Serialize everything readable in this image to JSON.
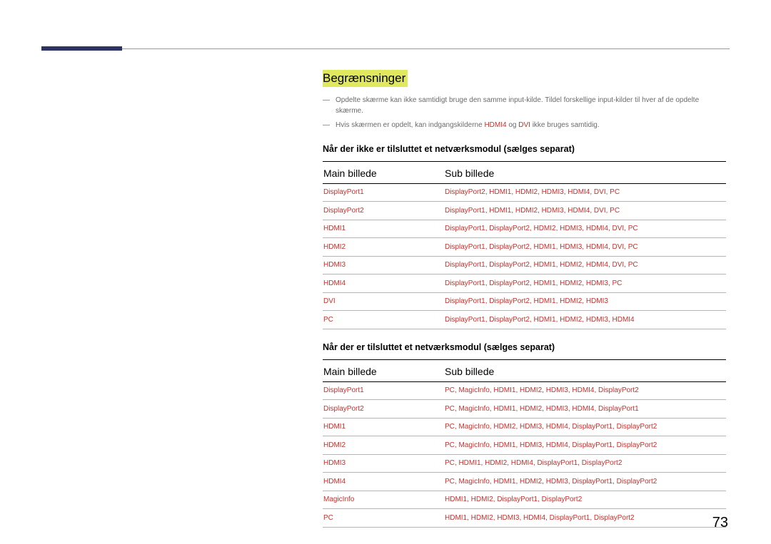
{
  "heading": "Begrænsninger",
  "notes": [
    "Opdelte skærme kan ikke samtidigt bruge den samme input-kilde. Tildel forskellige input-kilder til hver af de opdelte skærme.",
    "Hvis skærmen er opdelt, kan indgangskilderne <r>HDMI4</r> og <r>DVI</r> ikke bruges samtidig."
  ],
  "section1": {
    "title": "Når der ikke er tilsluttet et netværksmodul (sælges separat)",
    "col_main": "Main billede",
    "col_sub": "Sub billede",
    "rows": [
      {
        "main": "DisplayPort1",
        "sub": "DisplayPort2, HDMI1, HDMI2, HDMI3, HDMI4, DVI, PC"
      },
      {
        "main": "DisplayPort2",
        "sub": "DisplayPort1, HDMI1, HDMI2, HDMI3, HDMI4, DVI, PC"
      },
      {
        "main": "HDMI1",
        "sub": "DisplayPort1, DisplayPort2, HDMI2, HDMI3, HDMI4, DVI, PC"
      },
      {
        "main": "HDMI2",
        "sub": "DisplayPort1, DisplayPort2, HDMI1, HDMI3, HDMI4, DVI, PC"
      },
      {
        "main": "HDMI3",
        "sub": "DisplayPort1, DisplayPort2, HDMI1, HDMI2, HDMI4, DVI, PC"
      },
      {
        "main": "HDMI4",
        "sub": "DisplayPort1, DisplayPort2, HDMI1, HDMI2, HDMI3, PC"
      },
      {
        "main": "DVI",
        "sub": "DisplayPort1, DisplayPort2, HDMI1, HDMI2, HDMI3"
      },
      {
        "main": "PC",
        "sub": "DisplayPort1, DisplayPort2, HDMI1, HDMI2, HDMI3, HDMI4"
      }
    ]
  },
  "section2": {
    "title": "Når der er tilsluttet et netværksmodul (sælges separat)",
    "col_main": "Main billede",
    "col_sub": "Sub billede",
    "rows": [
      {
        "main": "DisplayPort1",
        "sub": "PC, MagicInfo, HDMI1, HDMI2, HDMI3, HDMI4, DisplayPort2"
      },
      {
        "main": "DisplayPort2",
        "sub": "PC, MagicInfo, HDMI1, HDMI2, HDMI3, HDMI4, DisplayPort1"
      },
      {
        "main": "HDMI1",
        "sub": "PC, MagicInfo, HDMI2, HDMI3, HDMI4, DisplayPort1, DisplayPort2"
      },
      {
        "main": "HDMI2",
        "sub": "PC, MagicInfo, HDMI1, HDMI3, HDMI4, DisplayPort1, DisplayPort2"
      },
      {
        "main": "HDMI3",
        "sub": "PC, HDMI1, HDMI2, HDMI4, DisplayPort1, DisplayPort2"
      },
      {
        "main": "HDMI4",
        "sub": "PC, MagicInfo, HDMI1, HDMI2, HDMI3, DisplayPort1, DisplayPort2"
      },
      {
        "main": "MagicInfo",
        "sub": "HDMI1, HDMI2, DisplayPort1, DisplayPort2"
      },
      {
        "main": "PC",
        "sub": "HDMI1, HDMI2, HDMI3, HDMI4, DisplayPort1, DisplayPort2"
      }
    ]
  },
  "page_number": "73"
}
